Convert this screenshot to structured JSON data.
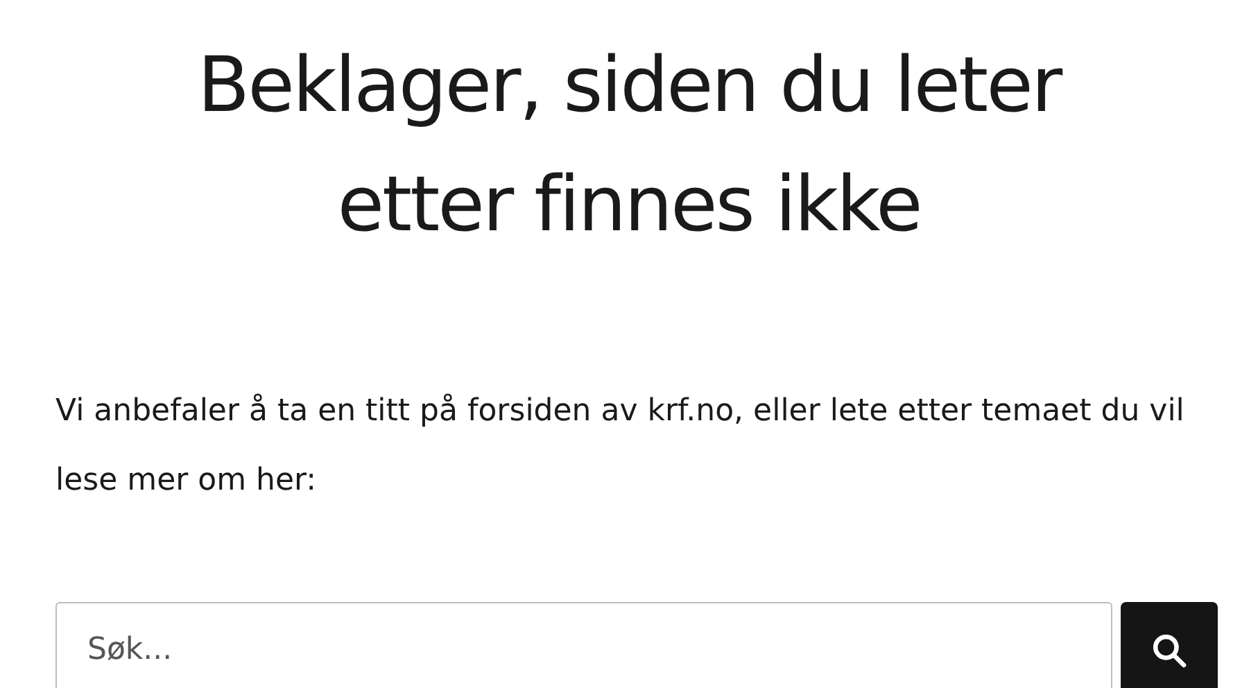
{
  "heading": "Beklager, siden du leter etter finnes ikke",
  "text": "Vi anbefaler å ta en titt på forsiden av krf.no, eller lete etter temaet du vil lese mer om her:",
  "search": {
    "placeholder": "Søk..."
  }
}
